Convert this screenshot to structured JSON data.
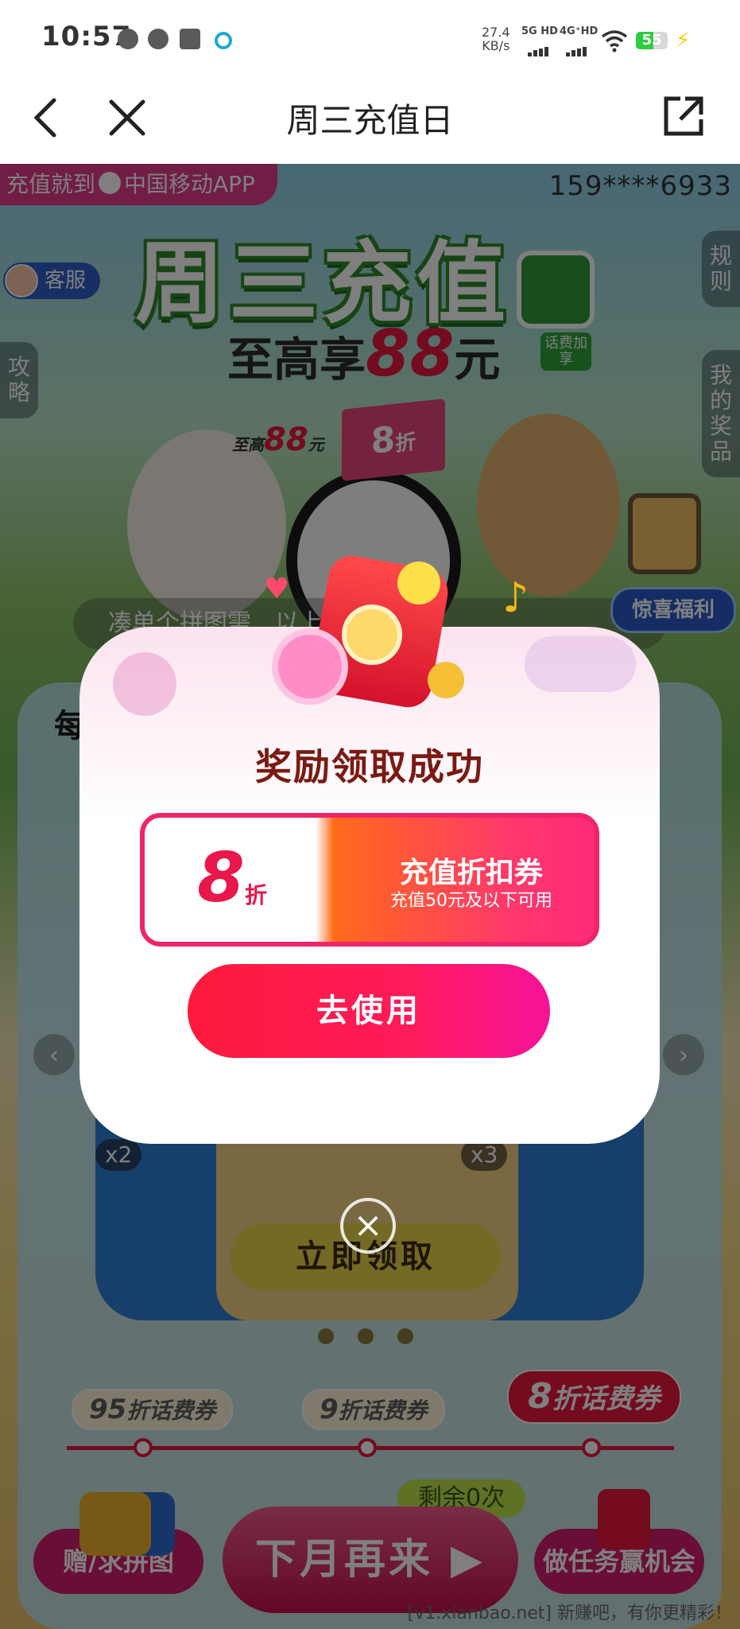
{
  "status_bar": {
    "time": "10:57",
    "net_speed_value": "27.4",
    "net_speed_unit": "KB/s",
    "sim1": "5G HD",
    "sim2": "4G⁺HD",
    "battery": "55",
    "battery_level": 0.55,
    "notification_icons": [
      "wechat-icon",
      "message-icon",
      "calendar-icon",
      "browser-icon"
    ]
  },
  "title_bar": {
    "title": "周三充值日",
    "back_icon": "chevron-left-icon",
    "close_icon": "close-icon",
    "share_icon": "share-icon"
  },
  "background_page": {
    "promo_tag": "充值就到",
    "promo_brand": "中国移动APP",
    "phone_masked": "159****6933",
    "customer_service": "客服",
    "left_side_tab": "攻略",
    "right_side_tabs": [
      "规则",
      "我的奖品"
    ],
    "hero_title": "周三充值",
    "hero_sub_prefix": "至高享",
    "hero_sub_amount": "88",
    "hero_sub_suffix": "元",
    "hero_badge": "话费加享",
    "flag_value": "8",
    "flag_unit": "折",
    "chick_badge_prefix": "至高",
    "chick_badge_amount": "88",
    "chick_badge_unit": "元",
    "scroll_notice": "凑单个拼图需…以上才能…",
    "surprise_button": "惊喜福利",
    "card_head": "每",
    "multipliers": [
      "x2",
      "x3"
    ],
    "claim_button": "立即领取",
    "tiers": [
      {
        "value": "95",
        "label": "折话费券"
      },
      {
        "value": "9",
        "label": "折话费券"
      },
      {
        "value": "8",
        "label": "折话费券"
      }
    ],
    "remaining": "剩余0次",
    "bottom_left": "赠/求拼图",
    "bottom_center": "下月再来 ▶",
    "bottom_right": "做任务赢机会",
    "watermark": "[v1.xianbao.net] 新赚吧，有你更精彩！"
  },
  "modal": {
    "title": "奖励领取成功",
    "coupon": {
      "value": "8",
      "unit": "折",
      "name": "充值折扣券",
      "desc": "充值50元及以下可用"
    },
    "use_button": "去使用",
    "close_icon": "close-circle-icon"
  },
  "colors": {
    "accent_red": "#e8173c",
    "pink": "#f0246a",
    "magenta": "#d21c6c",
    "modal_title": "#7a1a12"
  }
}
